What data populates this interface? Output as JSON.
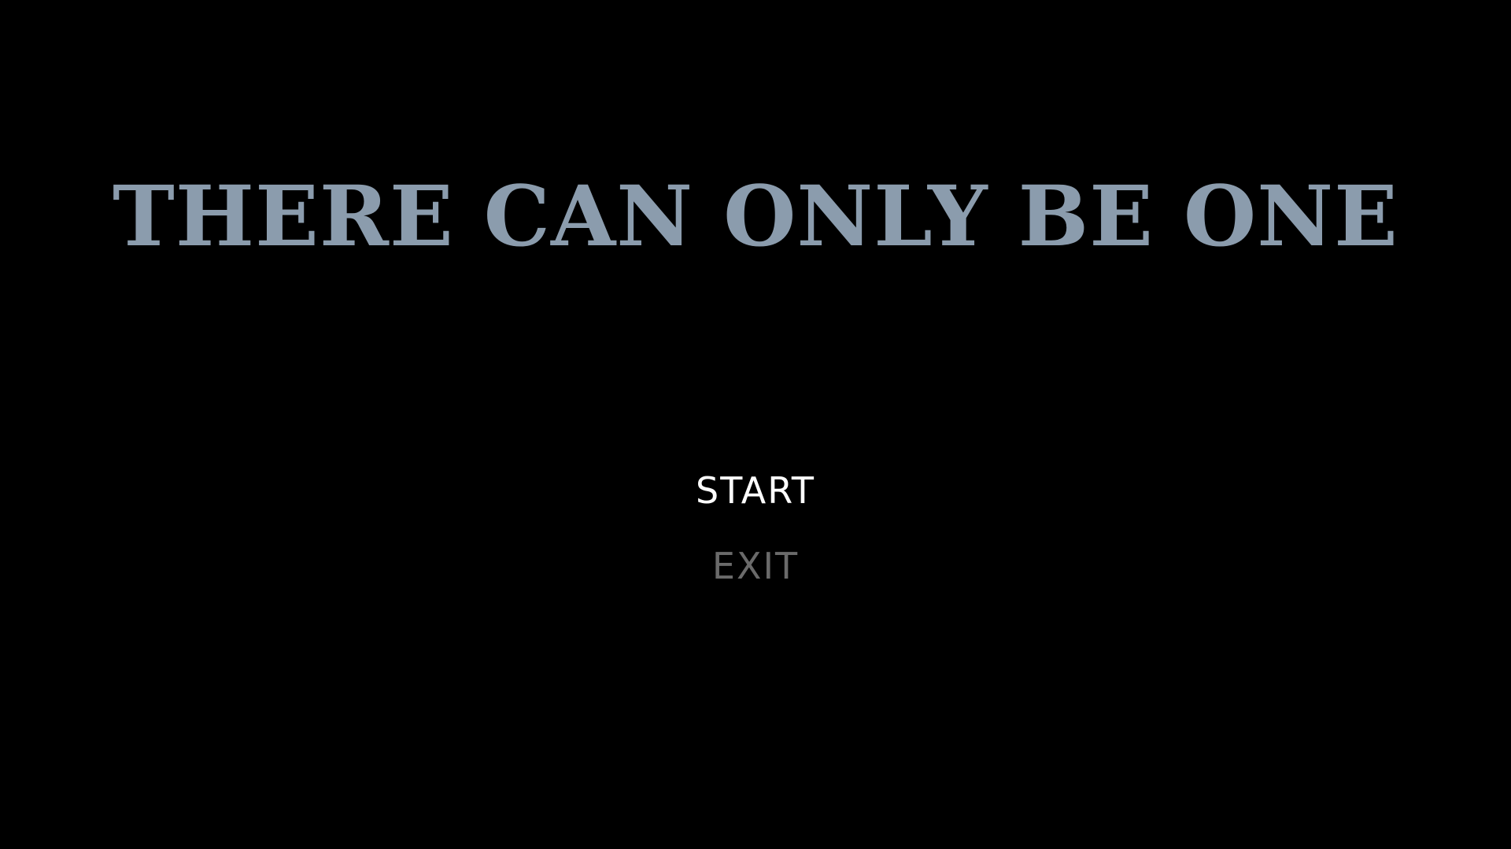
{
  "title": "THERE CAN ONLY BE ONE",
  "menu": {
    "items": [
      {
        "label": "START",
        "selected": true
      },
      {
        "label": "EXIT",
        "selected": false
      }
    ]
  },
  "colors": {
    "background": "#000000",
    "title": "#8b9cad",
    "selected_item": "#ffffff",
    "unselected_item": "#6a6a6a"
  }
}
